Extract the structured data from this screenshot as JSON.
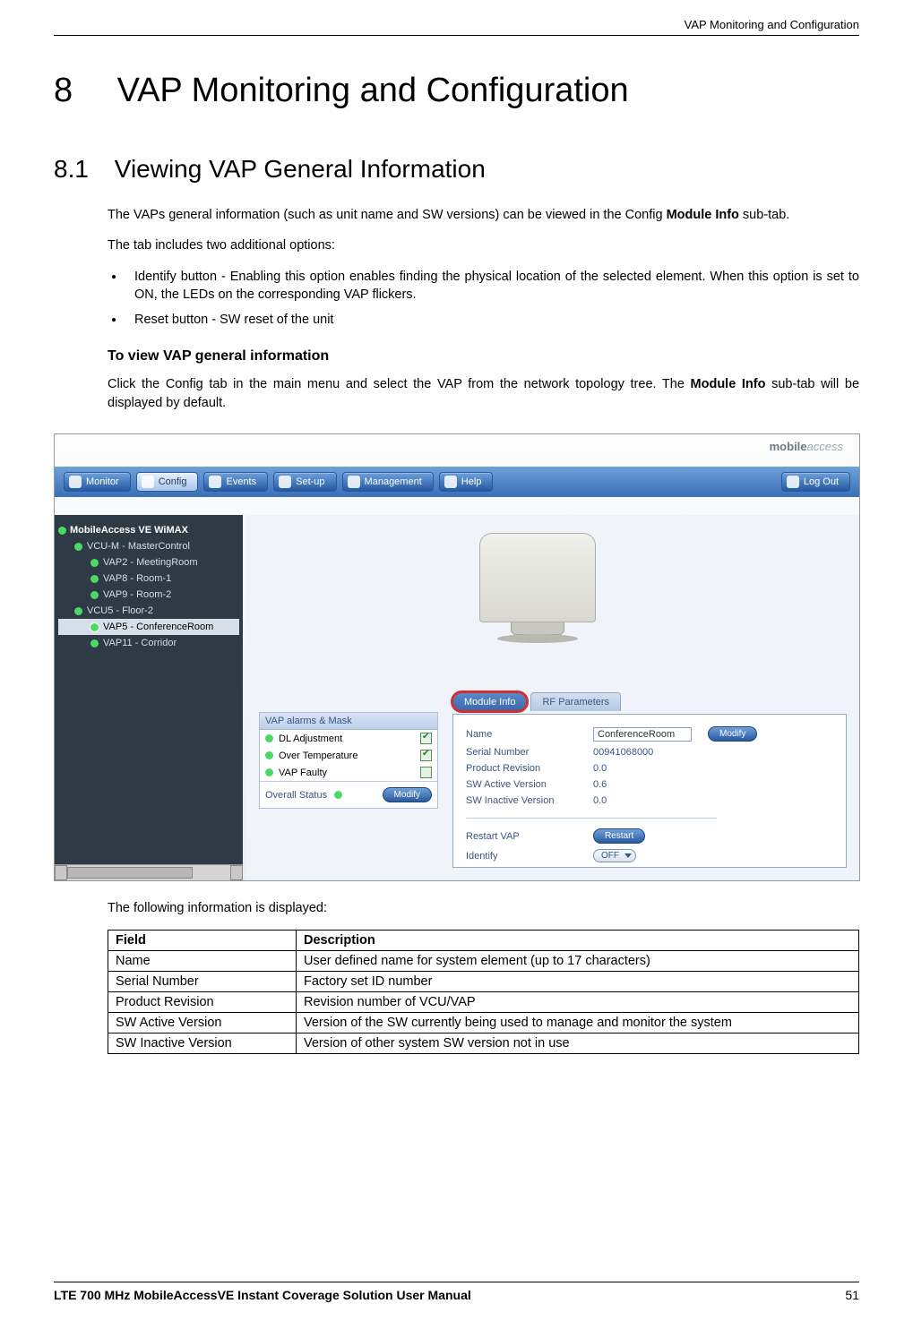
{
  "header": {
    "running_title": "VAP Monitoring and Configuration"
  },
  "chapter": {
    "number": "8",
    "title": "VAP Monitoring and Configuration"
  },
  "section": {
    "number": "8.1",
    "title": "Viewing VAP General Information"
  },
  "paragraphs": {
    "intro_a": "The VAPs general information (such as unit name and SW versions) can be viewed in the Config ",
    "intro_bold": "Module Info",
    "intro_b": " sub-tab.",
    "options_lead": "The tab includes two additional options:",
    "bullet1": "Identify button - Enabling this option enables finding the physical location of the selected element. When this option is set to ON, the LEDs on the corresponding VAP flickers.",
    "bullet2": "Reset button - SW reset of the unit",
    "procedure_heading": "To view VAP general information",
    "procedure_a": "Click the Config tab in the main menu and select the VAP from the network topology tree. The ",
    "procedure_bold": "Module Info",
    "procedure_b": " sub-tab will be displayed by default.",
    "table_lead": "The following information is displayed:"
  },
  "ui": {
    "logo_a": "mobile",
    "logo_b": "access",
    "menubar": {
      "monitor": "Monitor",
      "config": "Config",
      "events": "Events",
      "setup": "Set-up",
      "management": "Management",
      "help": "Help",
      "logout": "Log Out"
    },
    "tree": {
      "root": "MobileAccess VE WiMAX",
      "items": [
        {
          "label": "VCU-M - MasterControl",
          "level": 1
        },
        {
          "label": "VAP2 - MeetingRoom",
          "level": 2
        },
        {
          "label": "VAP8 - Room-1",
          "level": 2
        },
        {
          "label": "VAP9 - Room-2",
          "level": 2
        },
        {
          "label": "VCU5 - Floor-2",
          "level": 1
        },
        {
          "label": "VAP5 - ConferenceRoom",
          "level": 2,
          "selected": true
        },
        {
          "label": "VAP11 - Corridor",
          "level": 2
        }
      ]
    },
    "alarms": {
      "title": "VAP alarms & Mask",
      "dl_adjustment": "DL Adjustment",
      "over_temperature": "Over Temperature",
      "vap_faulty": "VAP Faulty",
      "overall_status": "Overall Status",
      "modify": "Modify"
    },
    "info_tabs": {
      "module_info": "Module Info",
      "rf_parameters": "RF Parameters"
    },
    "module_info": {
      "name_label": "Name",
      "name_value": "ConferenceRoom",
      "modify": "Modify",
      "serial_label": "Serial Number",
      "serial_value": "00941068000",
      "prodrev_label": "Product Revision",
      "prodrev_value": "0.0",
      "swactive_label": "SW Active Version",
      "swactive_value": "0.6",
      "swinactive_label": "SW Inactive Version",
      "swinactive_value": "0.0",
      "restart_label": "Restart VAP",
      "restart_btn": "Restart",
      "identify_label": "Identify",
      "identify_value": "OFF"
    }
  },
  "table": {
    "h_field": "Field",
    "h_desc": "Description",
    "rows": [
      {
        "field": "Name",
        "desc": "User defined name for system element (up to 17 characters)"
      },
      {
        "field": "Serial Number",
        "desc": "Factory set ID number"
      },
      {
        "field": "Product Revision",
        "desc": "Revision number of VCU/VAP"
      },
      {
        "field": "SW Active Version",
        "desc": "Version of the SW currently being used to manage and monitor the system"
      },
      {
        "field": "SW Inactive Version",
        "desc": "Version  of other system SW version not in use"
      }
    ]
  },
  "footer": {
    "doc_title": "LTE 700 MHz MobileAccessVE Instant Coverage Solution User Manual",
    "page": "51"
  }
}
